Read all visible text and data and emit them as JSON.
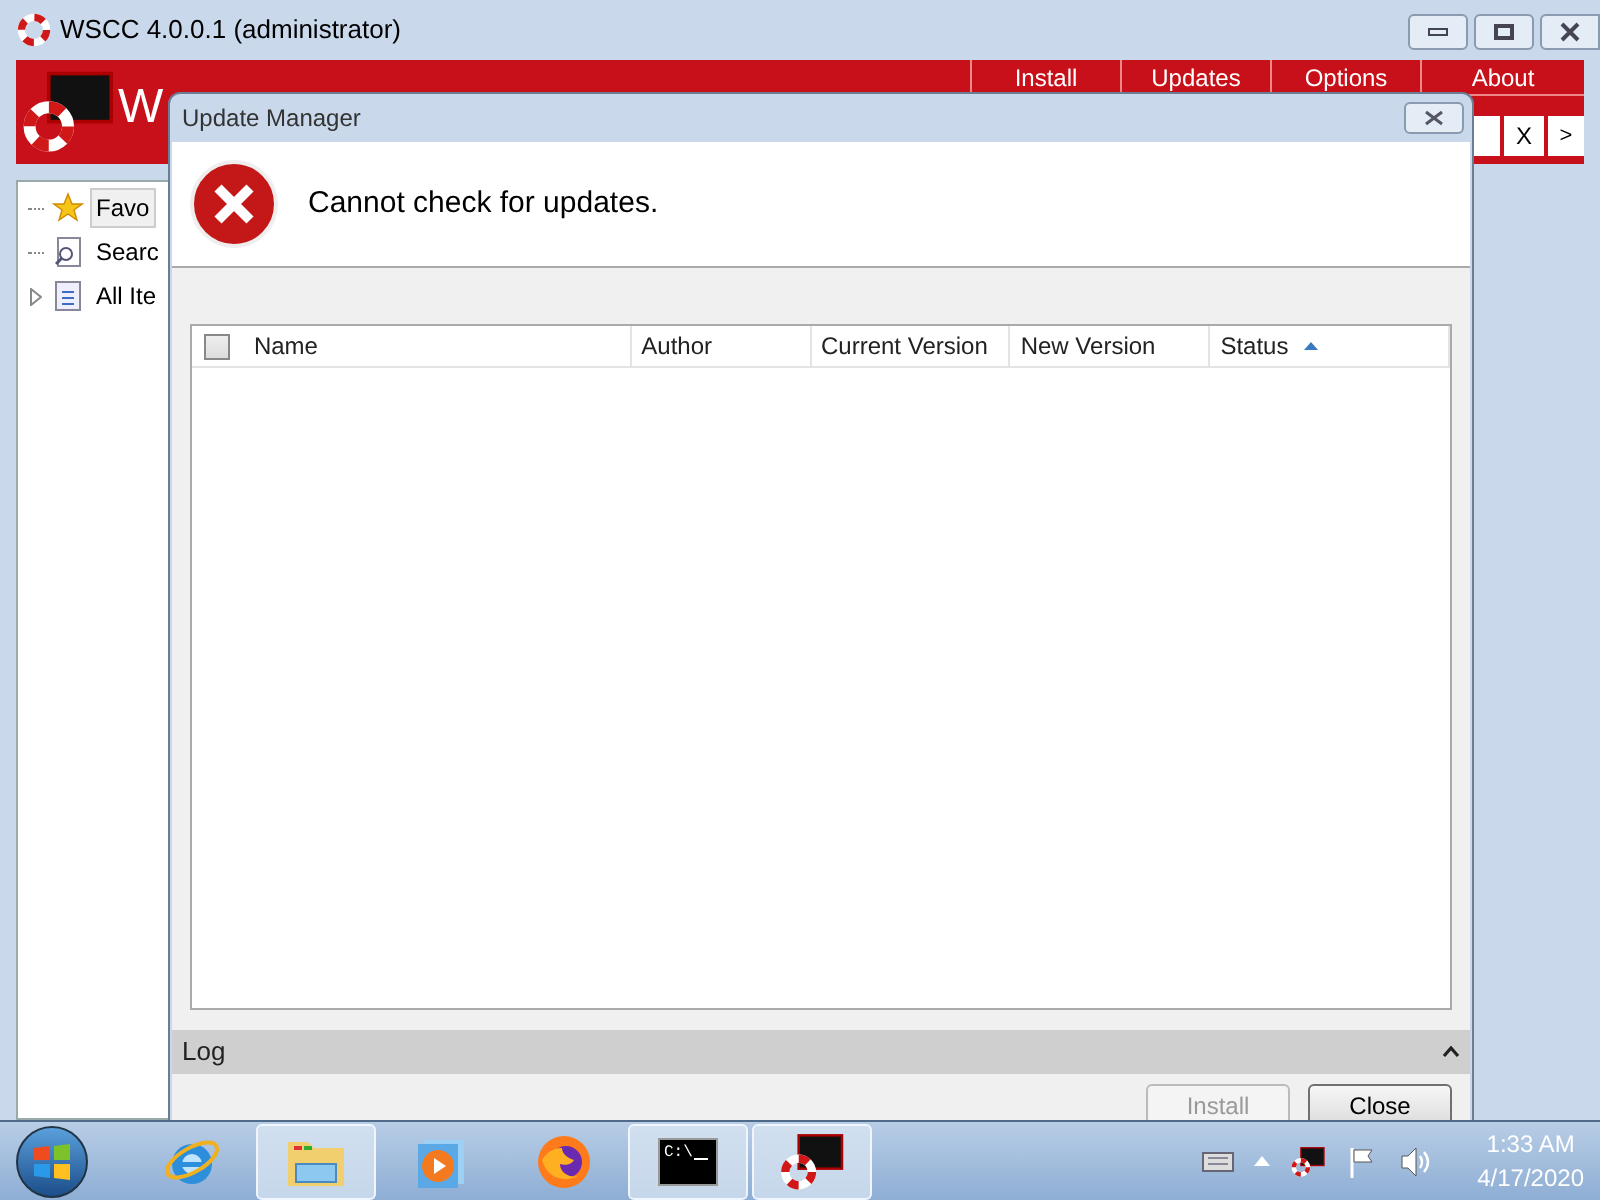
{
  "main_window": {
    "title": "WSCC 4.0.0.1 (administrator)",
    "banner_text": "W",
    "menu_tabs": [
      "Install",
      "Updates",
      "Options",
      "About"
    ],
    "search_buttons": [
      "X",
      ">"
    ],
    "tree": [
      {
        "label": "Favo",
        "kind": "favorites",
        "selected": true,
        "expander": false
      },
      {
        "label": "Searc",
        "kind": "search",
        "selected": false,
        "expander": false
      },
      {
        "label": "All Ite",
        "kind": "category",
        "selected": false,
        "expander": true
      }
    ]
  },
  "dialog": {
    "title": "Update Manager",
    "message": "Cannot check for updates.",
    "select_all_checked": false,
    "columns": [
      {
        "label": "Name",
        "sorted": false
      },
      {
        "label": "Author",
        "sorted": false
      },
      {
        "label": "Current Version",
        "sorted": false
      },
      {
        "label": "New Version",
        "sorted": false
      },
      {
        "label": "Status",
        "sorted": true
      }
    ],
    "log_label": "Log",
    "buttons": [
      {
        "label": "Install",
        "disabled": true
      },
      {
        "label": "Close",
        "disabled": false
      }
    ]
  },
  "taskbar": {
    "items": [
      {
        "kind": "ie",
        "active": false
      },
      {
        "kind": "explorer",
        "active": true
      },
      {
        "kind": "media",
        "active": false
      },
      {
        "kind": "firefox",
        "active": false
      },
      {
        "kind": "cmd",
        "active": true,
        "text": "C:\\"
      },
      {
        "kind": "wscc",
        "active": true
      }
    ],
    "time": "1:33 AM",
    "date": "4/17/2020"
  }
}
